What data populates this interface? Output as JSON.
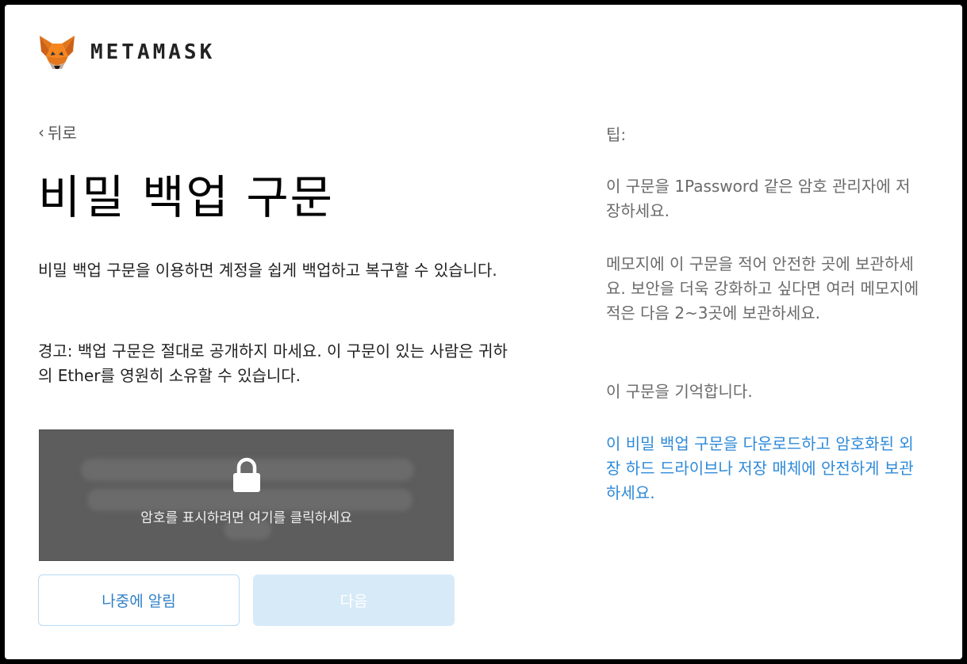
{
  "brand": {
    "wordmark": "METAMASK",
    "logo_icon": "metamask-fox-icon"
  },
  "nav": {
    "back_label": "뒤로",
    "back_icon": "chevron-left-icon"
  },
  "main": {
    "title": "비밀 백업 구문",
    "description": "비밀 백업 구문을 이용하면 계정을 쉽게 백업하고 복구할 수 있습니다.",
    "warning": "경고: 백업 구문은 절대로 공개하지 마세요. 이 구문이 있는 사람은 귀하의 Ether를 영원히 소유할 수 있습니다.",
    "secret_box": {
      "lock_icon": "lock-icon",
      "reveal_text": "암호를 표시하려면 여기를 클릭하세요"
    },
    "buttons": {
      "remind_later": "나중에 알림",
      "next": "다음"
    }
  },
  "tips": {
    "heading": "팁:",
    "items": [
      "이 구문을 1Password 같은 암호 관리자에 저장하세요.",
      "메모지에 이 구문을 적어 안전한 곳에 보관하세요. 보안을 더욱 강화하고 싶다면 여러 메모지에 적은 다음 2~3곳에 보관하세요.",
      "이 구문을 기억합니다."
    ],
    "download_link": "이 비밀 백업 구문을 다운로드하고 암호화된 외장 하드 드라이브나 저장 매체에 안전하게 보관하세요."
  },
  "colors": {
    "accent": "#2f8ad8",
    "box_bg": "#5d5d5d",
    "next_disabled": "#d7eaf8"
  }
}
